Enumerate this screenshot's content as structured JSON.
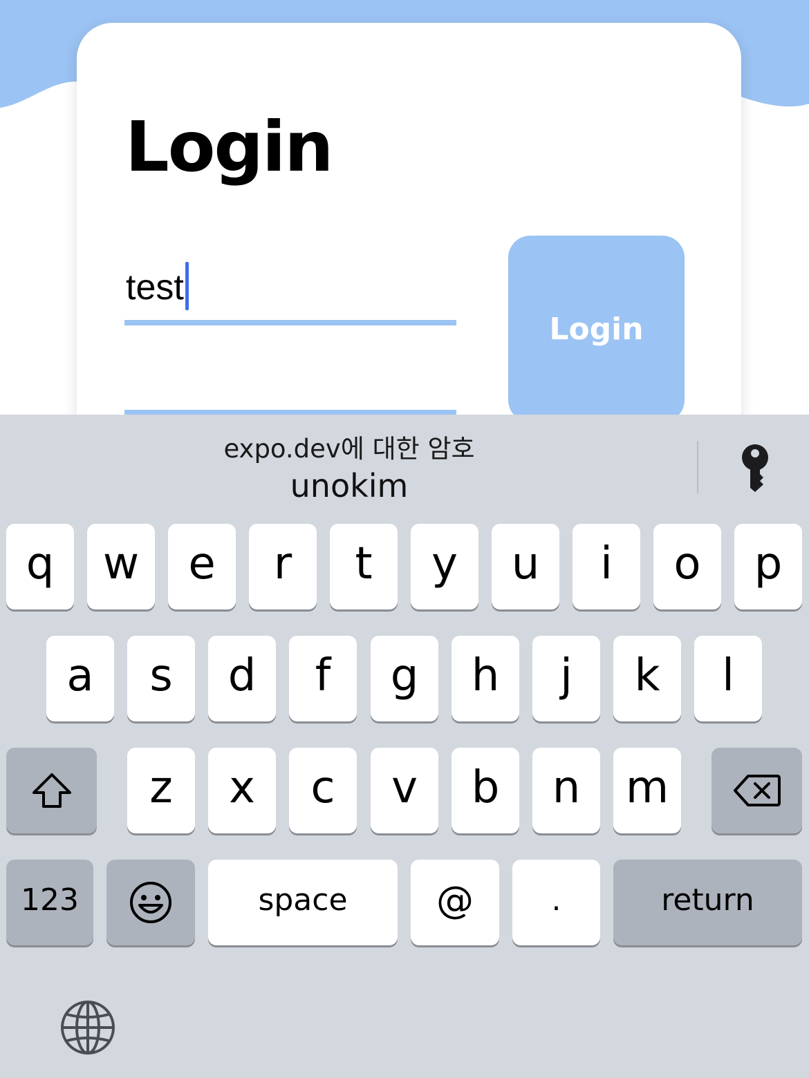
{
  "app": {
    "title": "Login",
    "username_value": "test",
    "password_value": "",
    "login_button_label": "Login",
    "accent_color": "#9bc3f3"
  },
  "keyboard": {
    "suggestion_caption": "expo.dev에 대한 암호",
    "suggestion_username": "unokim",
    "suggestion_icon": "key-icon",
    "row1": [
      "q",
      "w",
      "e",
      "r",
      "t",
      "y",
      "u",
      "i",
      "o",
      "p"
    ],
    "row2": [
      "a",
      "s",
      "d",
      "f",
      "g",
      "h",
      "j",
      "k",
      "l"
    ],
    "row3": [
      "z",
      "x",
      "c",
      "v",
      "b",
      "n",
      "m"
    ],
    "shift_icon": "shift-icon",
    "delete_icon": "backspace-icon",
    "numbers_label": "123",
    "emoji_icon": "emoji-icon",
    "space_label": "space",
    "at_label": "@",
    "period_label": ".",
    "return_label": "return",
    "globe_icon": "globe-icon"
  }
}
